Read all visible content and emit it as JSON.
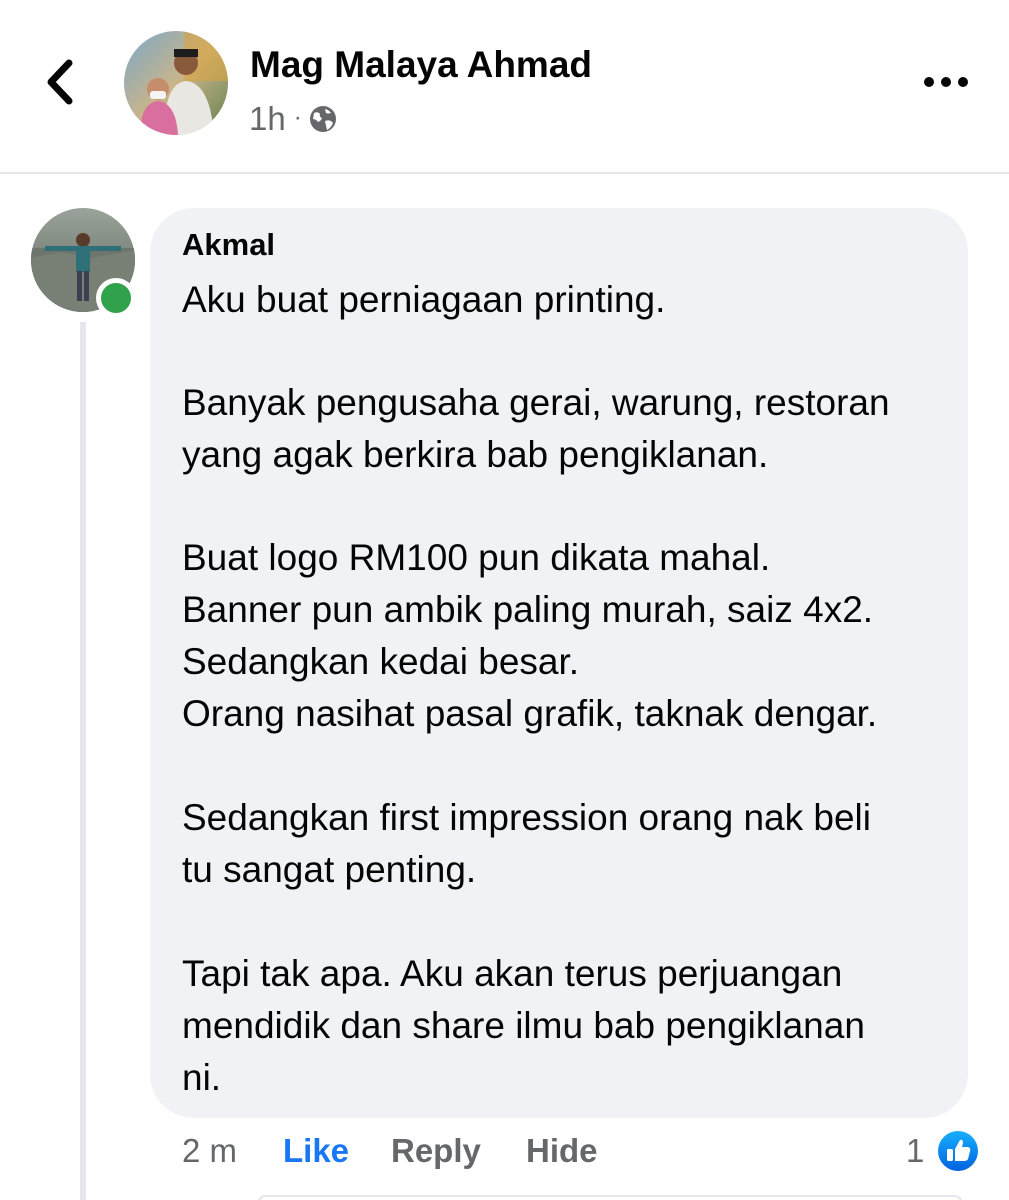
{
  "header": {
    "back_icon": "chevron-left-icon",
    "author_name": "Mag Malaya Ahmad",
    "time": "1h",
    "separator": "·",
    "privacy_icon": "globe-icon",
    "more_icon": "more-horizontal-icon"
  },
  "comment": {
    "author": "Akmal",
    "online": true,
    "lines": [
      "Aku buat perniagaan printing.",
      "Banyak pengusaha gerai, warung, restoran",
      "yang agak berkira bab pengiklanan.",
      "Buat logo RM100 pun dikata mahal.",
      "Banner pun ambik paling murah, saiz 4x2.",
      "Sedangkan kedai besar.",
      "Orang nasihat pasal grafik, taknak dengar.",
      "Sedangkan first impression orang nak beli",
      "tu sangat penting.",
      "Tapi tak apa. Aku akan terus perjuangan",
      "mendidik dan share ilmu bab pengiklanan",
      "ni."
    ],
    "time": "2 m",
    "like_label": "Like",
    "reply_label": "Reply",
    "hide_label": "Hide",
    "reaction_count": "1",
    "reaction_icon": "like-reaction-icon"
  },
  "colors": {
    "link_blue": "#1877f2",
    "secondary_text": "#65676b",
    "bubble_bg": "#f0f2f5",
    "online_green": "#31a24c"
  }
}
